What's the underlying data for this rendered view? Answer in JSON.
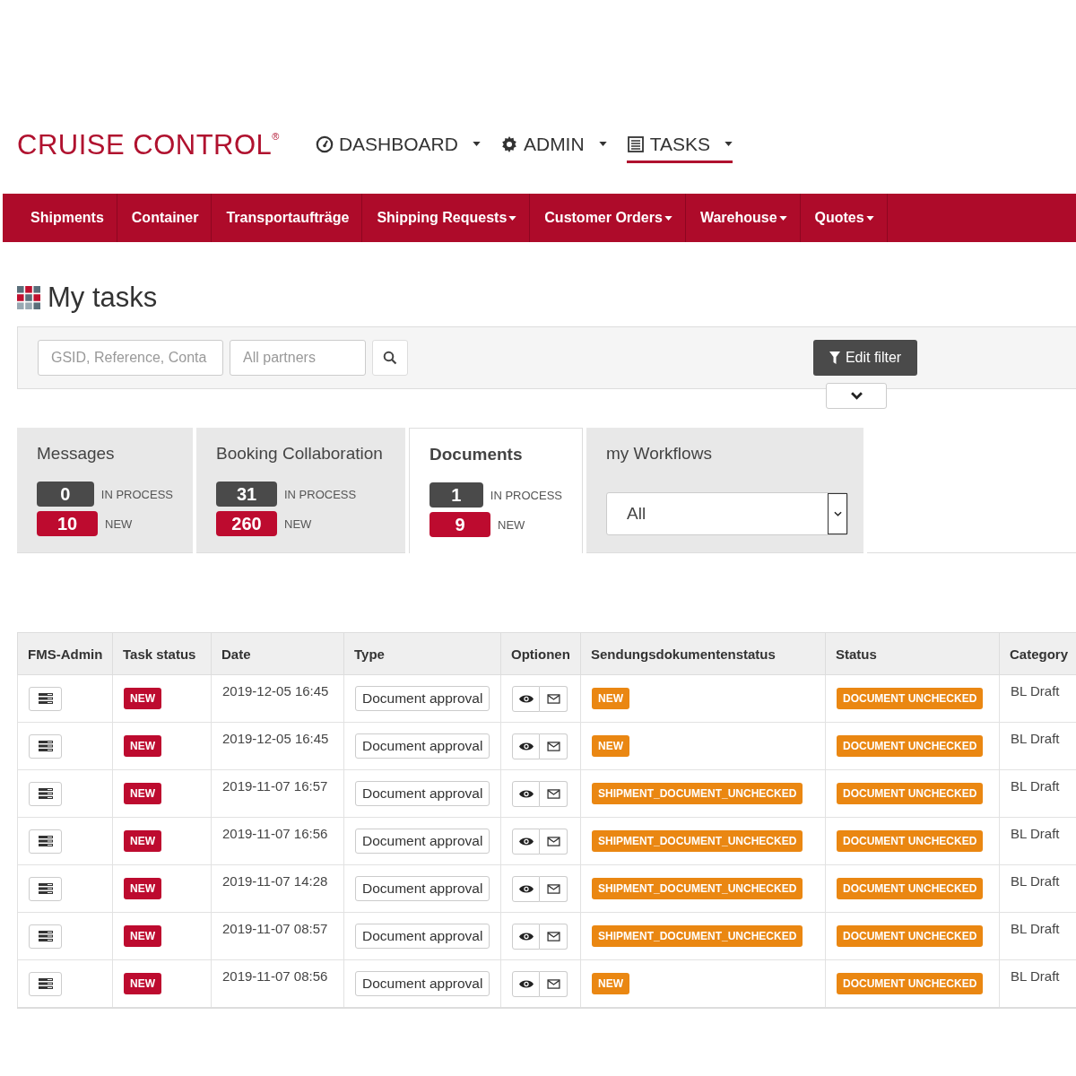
{
  "logo": "CRUISE CONTROL$^{®}$",
  "top_nav": [
    {
      "label": "DASHBOARD",
      "kind": "gauge",
      "selected": false
    },
    {
      "label": "ADMIN",
      "kind": "gear",
      "selected": false
    },
    {
      "label": "TASKS",
      "kind": "list",
      "selected": true
    }
  ],
  "main_nav": [
    {
      "label": "Shipments",
      "has_menu": false
    },
    {
      "label": "Container",
      "has_menu": false
    },
    {
      "label": "Transportaufträge",
      "has_menu": false
    },
    {
      "label": "Shipping Requests",
      "has_menu": true
    },
    {
      "label": "Customer Orders",
      "has_menu": true
    },
    {
      "label": "Warehouse",
      "has_menu": true
    },
    {
      "label": "Quotes",
      "has_menu": true
    }
  ],
  "page_title": "My tasks",
  "filter": {
    "search_placeholder": "GSID, Reference, Conta",
    "partners_placeholder": "All partners",
    "edit_filter": "Edit filter"
  },
  "tabs": [
    {
      "kind": "counts",
      "title": "Messages",
      "selected": false,
      "in_process": "0",
      "in_process_label": "IN PROCESS",
      "new": "10",
      "new_label": "NEW"
    },
    {
      "kind": "counts",
      "title": "Booking Collaboration",
      "selected": false,
      "in_process": "31",
      "in_process_label": "IN PROCESS",
      "new": "260",
      "new_label": "NEW"
    },
    {
      "kind": "counts",
      "title": "Documents",
      "selected": true,
      "in_process": "1",
      "in_process_label": "IN PROCESS",
      "new": "9",
      "new_label": "NEW"
    },
    {
      "kind": "select",
      "title": "my Workflows",
      "selected": false,
      "value": "All"
    }
  ],
  "table": {
    "columns": [
      "FMS-Admin",
      "Task status",
      "Date",
      "Type",
      "Optionen",
      "Sendungsdokumentenstatus",
      "Status",
      "Category"
    ],
    "rows": [
      {
        "task_status": "NEW",
        "date": "2019-12-05 16:45",
        "type": "Document approval",
        "doc_status": "NEW",
        "status": "DOCUMENT UNCHECKED",
        "category": "BL Draft"
      },
      {
        "task_status": "NEW",
        "date": "2019-12-05 16:45",
        "type": "Document approval",
        "doc_status": "NEW",
        "status": "DOCUMENT UNCHECKED",
        "category": "BL Draft"
      },
      {
        "task_status": "NEW",
        "date": "2019-11-07 16:57",
        "type": "Document approval",
        "doc_status": "SHIPMENT_DOCUMENT_UNCHECKED",
        "status": "DOCUMENT UNCHECKED",
        "category": "BL Draft"
      },
      {
        "task_status": "NEW",
        "date": "2019-11-07 16:56",
        "type": "Document approval",
        "doc_status": "SHIPMENT_DOCUMENT_UNCHECKED",
        "status": "DOCUMENT UNCHECKED",
        "category": "BL Draft"
      },
      {
        "task_status": "NEW",
        "date": "2019-11-07 14:28",
        "type": "Document approval",
        "doc_status": "SHIPMENT_DOCUMENT_UNCHECKED",
        "status": "DOCUMENT UNCHECKED",
        "category": "BL Draft"
      },
      {
        "task_status": "NEW",
        "date": "2019-11-07 08:57",
        "type": "Document approval",
        "doc_status": "SHIPMENT_DOCUMENT_UNCHECKED",
        "status": "DOCUMENT UNCHECKED",
        "category": "BL Draft"
      },
      {
        "task_status": "NEW",
        "date": "2019-11-07 08:56",
        "type": "Document approval",
        "doc_status": "NEW",
        "status": "DOCUMENT UNCHECKED",
        "category": "BL Draft"
      }
    ]
  }
}
